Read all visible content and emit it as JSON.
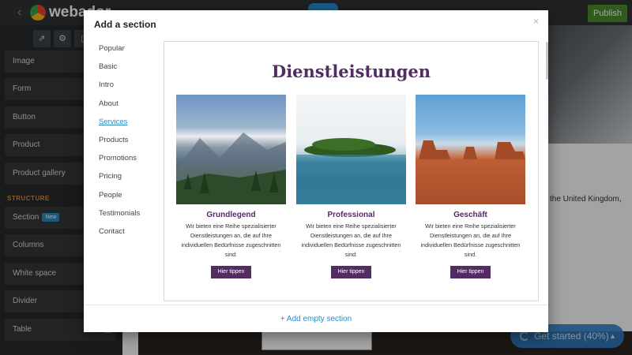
{
  "app": {
    "name": "webador",
    "publish_label": "Publish"
  },
  "sidebar": {
    "items_top": [
      "Image",
      "Form",
      "Button",
      "Product",
      "Product gallery"
    ],
    "structure_heading": "STRUCTURE",
    "section_label": "Section",
    "new_badge": "New",
    "items_bottom": [
      "Columns",
      "White space",
      "Divider",
      "Table"
    ]
  },
  "canvas": {
    "partial_text": "the United Kingdom,"
  },
  "get_started": {
    "label": "Get started (40%)"
  },
  "modal": {
    "title": "Add a section",
    "close_glyph": "×",
    "categories": [
      "Popular",
      "Basic",
      "Intro",
      "About",
      "Services",
      "Products",
      "Promotions",
      "Pricing",
      "People",
      "Testimonials",
      "Contact"
    ],
    "active_category": "Services",
    "preview": {
      "title": "Dienstleistungen",
      "cards": [
        {
          "title": "Grundlegend",
          "text": "Wir bieten eine Reihe spezialisierter Dienstleistungen an, die auf Ihre individuellen Bedürfnisse zugeschnitten sind.",
          "button": "Hier tippen"
        },
        {
          "title": "Professional",
          "text": "Wir bieten eine Reihe spezialisierter Dienstleistungen an, die auf Ihre individuellen Bedürfnisse zugeschnitten sind.",
          "button": "Hier tippen"
        },
        {
          "title": "Geschäft",
          "text": "Wir bieten eine Reihe spezialisierter Dienstleistungen an, die auf Ihre individuellen Bedürfnisse zugeschnitten sind.",
          "button": "Hier tippen"
        }
      ]
    },
    "footer_action": "+ Add empty section"
  },
  "colors": {
    "accent_purple": "#532c63",
    "link_blue": "#2b8bc0",
    "publish_green": "#4a8c2c"
  }
}
